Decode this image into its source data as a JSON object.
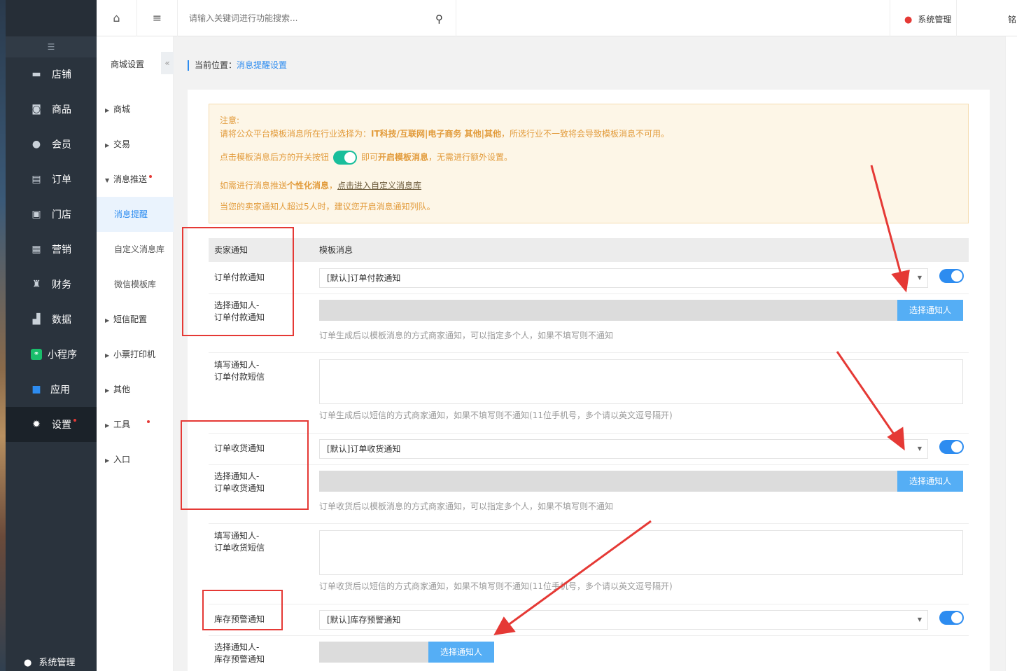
{
  "sidebar": {
    "collapse_icon": "menu-fold-icon",
    "items": [
      {
        "label": "店铺",
        "icon": "shop-icon"
      },
      {
        "label": "商品",
        "icon": "goods-icon"
      },
      {
        "label": "会员",
        "icon": "user-icon"
      },
      {
        "label": "订单",
        "icon": "order-icon"
      },
      {
        "label": "门店",
        "icon": "store-icon"
      },
      {
        "label": "营销",
        "icon": "gift-icon"
      },
      {
        "label": "财务",
        "icon": "money-bag-icon"
      },
      {
        "label": "数据",
        "icon": "chart-icon"
      },
      {
        "label": "小程序",
        "icon": "miniprogram-icon"
      },
      {
        "label": "应用",
        "icon": "apps-icon"
      },
      {
        "label": "设置",
        "icon": "gear-icon"
      }
    ],
    "footer": "系统管理"
  },
  "subnav": {
    "title": "商城设置",
    "items": [
      {
        "label": "商城"
      },
      {
        "label": "交易"
      },
      {
        "label": "消息推送"
      },
      {
        "label": "消息提醒"
      },
      {
        "label": "自定义消息库"
      },
      {
        "label": "微信模板库"
      },
      {
        "label": "短信配置"
      },
      {
        "label": "小票打印机"
      },
      {
        "label": "其他"
      },
      {
        "label": "工具"
      },
      {
        "label": "入口"
      }
    ]
  },
  "topbar": {
    "search_placeholder": "请输入关键词进行功能搜索...",
    "admin_label": "系统管理",
    "overflow_text": "铭"
  },
  "breadcrumb": {
    "prefix": "当前位置：",
    "current": "消息提醒设置"
  },
  "notice": {
    "title": "注意:",
    "line1_a": "请将公众平台模板消息所在行业选择为：",
    "line1_b": "IT科技/互联网|电子商务 其他|其他",
    "line1_c": "，所选行业不一致将会导致模板消息不可用。",
    "line2_a": "点击模板消息后方的开关按钮",
    "line2_b": "即可",
    "line2_c": "开启模板消息",
    "line2_d": "，无需进行额外设置。",
    "line3_a": "如需进行消息推送",
    "line3_b": "个性化消息",
    "line3_c": "，",
    "line3_link": "点击进入自定义消息库",
    "line4": "当您的卖家通知人超过5人时，建议您开启消息通知列队。"
  },
  "table": {
    "col1": "卖家通知",
    "col2": "模板消息",
    "rows": {
      "pay_label": "订单付款通知",
      "pay_select": "[默认]订单付款通知",
      "pay_person_l1": "选择通知人-",
      "pay_person_l2": "订单付款通知",
      "pay_button": "选择通知人",
      "pay_hint": "订单生成后以模板消息的方式商家通知，可以指定多个人，如果不填写则不通知",
      "pay_sms_l1": "填写通知人-",
      "pay_sms_l2": "订单付款短信",
      "pay_sms_hint": "订单生成后以短信的方式商家通知，如果不填写则不通知(11位手机号，多个请以英文逗号隔开)",
      "recv_label": "订单收货通知",
      "recv_select": "[默认]订单收货通知",
      "recv_person_l1": "选择通知人-",
      "recv_person_l2": "订单收货通知",
      "recv_button": "选择通知人",
      "recv_hint": "订单收货后以模板消息的方式商家通知，可以指定多个人，如果不填写则不通知",
      "recv_sms_l1": "填写通知人-",
      "recv_sms_l2": "订单收货短信",
      "recv_sms_hint": "订单收货后以短信的方式商家通知，如果不填写则不通知(11位手机号，多个请以英文逗号隔开)",
      "stock_label": "库存预警通知",
      "stock_select": "[默认]库存预警通知",
      "stock_person_l1": "选择通知人-",
      "stock_person_l2": "库存预警通知",
      "stock_button": "选择通知人"
    }
  },
  "colors": {
    "accent": "#2d8cf0",
    "annotation": "#e53935",
    "notice_text": "#e29b3b",
    "sidebar_bg": "#2a333d"
  }
}
